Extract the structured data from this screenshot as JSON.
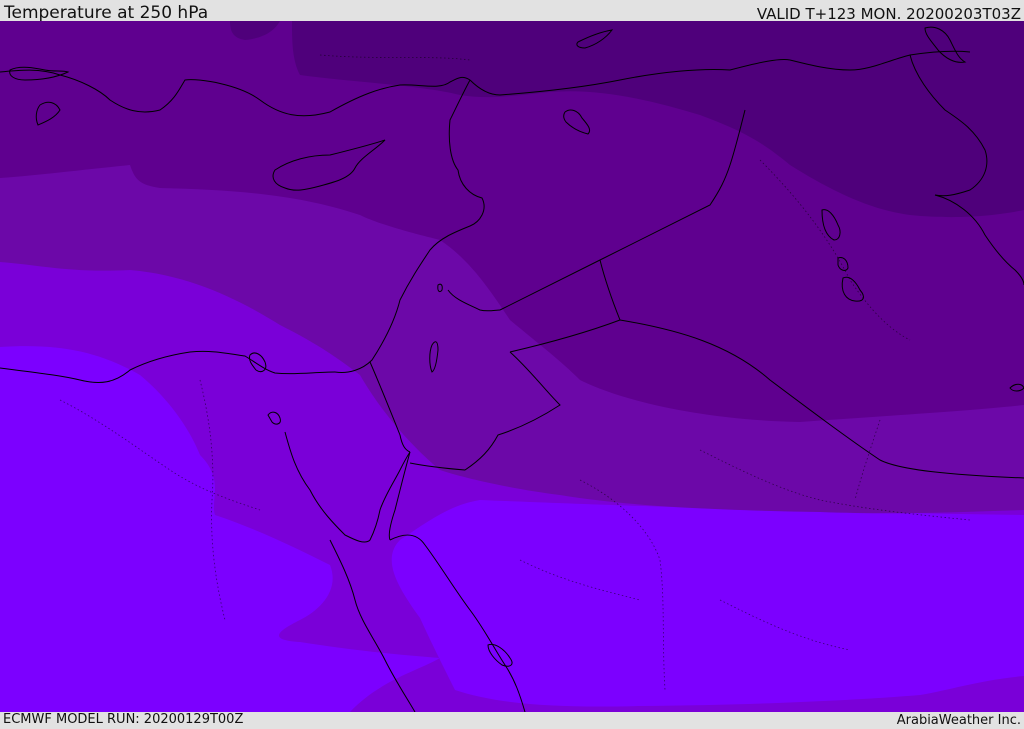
{
  "header": {
    "title": "Temperature at 250 hPa",
    "valid_time": "VALID T+123 MON. 20200203T03Z"
  },
  "footer": {
    "model_run": "ECMWF MODEL RUN: 20200129T00Z",
    "credit": "ArabiaWeather Inc."
  },
  "map": {
    "region": "Eastern Mediterranean / Middle East",
    "field": "temperature",
    "level": "250 hPa",
    "fill_colors": {
      "coldest": "#4f007b",
      "cold": "#5f008f",
      "cool": "#6c08a8",
      "mild": "#7a00d8",
      "warmest": "#7c00ff"
    },
    "outline_color": "#000000"
  }
}
